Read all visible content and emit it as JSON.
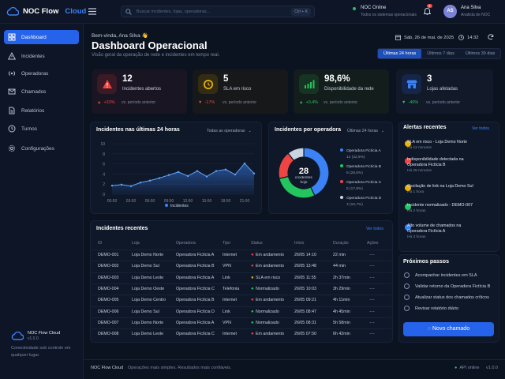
{
  "brand": {
    "name": "NOC Flow",
    "accent": "Cloud"
  },
  "search": {
    "placeholder": "Buscar incidentes, lojas, operadoras...",
    "shortcut": "Ctrl + K"
  },
  "status": {
    "title": "NOC Online",
    "subtitle": "Todos os sistemas operacionais",
    "color": "#22c55e"
  },
  "notifications": {
    "count": "3"
  },
  "user": {
    "initials": "AS",
    "name": "Ana Silva",
    "role": "Analista de NOC"
  },
  "sidebar": {
    "items": [
      {
        "label": "Dashboard",
        "icon": "grid-icon"
      },
      {
        "label": "Incidentes",
        "icon": "warning-icon"
      },
      {
        "label": "Operadoras",
        "icon": "signal-icon"
      },
      {
        "label": "Chamados",
        "icon": "ticket-icon"
      },
      {
        "label": "Relatórios",
        "icon": "document-icon"
      },
      {
        "label": "Turnos",
        "icon": "clock-icon"
      },
      {
        "label": "Configurações",
        "icon": "gear-icon"
      }
    ],
    "footer": {
      "name": "NOC Flow Cloud",
      "version": "v1.0.0",
      "caption": "Conectividade sob controle em qualquer lugar."
    }
  },
  "header": {
    "welcome": "Bem-vinda, Ana Silva 👋",
    "title": "Dashboard Operacional",
    "subtitle": "Visão geral da operação de rede e incidentes em tempo real.",
    "date": "Sáb, 26 de mai. de 2025",
    "time": "14:32"
  },
  "range_tabs": [
    "Últimas 24 horas",
    "Últimos 7 dias",
    "Últimos 30 dias"
  ],
  "kpis": [
    {
      "value": "12",
      "label": "Incidentes abertos",
      "delta": "+33%",
      "compare": "vs. período anterior",
      "color": "#ef4444",
      "bg": "#2a1620",
      "icon": "alert-triangle-icon"
    },
    {
      "value": "5",
      "label": "SLA em risco",
      "delta": "-17%",
      "compare": "vs. período anterior",
      "color": "#eab308",
      "bg": "#2a2616",
      "icon": "clock-icon"
    },
    {
      "value": "98,6%",
      "label": "Disponibilidade da rede",
      "delta": "+0,4%",
      "compare": "vs. período anterior",
      "color": "#22c55e",
      "bg": "#13261d",
      "icon": "bars-icon"
    },
    {
      "value": "3",
      "label": "Lojas afetadas",
      "delta": "-40%",
      "compare": "vs. período anterior",
      "color": "#3b82f6",
      "bg": "#131f38",
      "icon": "store-icon"
    }
  ],
  "line_panel": {
    "title": "Incidentes nas últimas 24 horas",
    "filter": "Todas as operadoras"
  },
  "donut_panel": {
    "title": "Incidentes por operadora",
    "filter": "Últimas 24 horas",
    "center_value": "28",
    "center_label": "incidentes hoje"
  },
  "chart_data": [
    {
      "type": "area",
      "title": "Incidentes nas últimas 24 horas",
      "x": [
        "00:00",
        "01:30",
        "03:00",
        "04:30",
        "06:00",
        "07:30",
        "09:00",
        "10:30",
        "12:00",
        "13:30",
        "15:00",
        "16:30",
        "18:00",
        "19:30",
        "21:00",
        "22:30"
      ],
      "series": [
        {
          "name": "Incidentes",
          "values": [
            1.7,
            1.9,
            1.6,
            2.3,
            2.7,
            3.2,
            3.8,
            4.4,
            3.6,
            4.6,
            3.5,
            4.6,
            4.9,
            3.9,
            6.1,
            4.1
          ]
        }
      ],
      "xticks": [
        "00:00",
        "03:00",
        "06:00",
        "09:00",
        "12:00",
        "15:00",
        "18:00",
        "21:00"
      ],
      "yticks": [
        "0",
        "2",
        "4",
        "6",
        "8",
        "10"
      ],
      "ylim": [
        0,
        10
      ],
      "grid": true,
      "legend": "bottom",
      "color": "#3b82f6"
    },
    {
      "type": "pie",
      "title": "Incidentes por operadora",
      "slices": [
        {
          "name": "Operadora Fictícia A",
          "value": 12,
          "label": "12 (42,9%)",
          "color": "#3b82f6"
        },
        {
          "name": "Operadora Fictícia B",
          "value": 8,
          "label": "8 (28,6%)",
          "color": "#22c55e"
        },
        {
          "name": "Operadora Fictícia C",
          "value": 5,
          "label": "5 (17,9%)",
          "color": "#ef4444"
        },
        {
          "name": "Operadora Fictícia D",
          "value": 3,
          "label": "3 (10,7%)",
          "color": "#cbd5e1"
        }
      ]
    }
  ],
  "alerts": {
    "title": "Alertas recentes",
    "link": "Ver todos",
    "items": [
      {
        "text": "SLA em risco - Loja Demo Norte",
        "time": "Há 12 minutos",
        "color": "#eab308"
      },
      {
        "text": "Indisponibilidade detectada na Operadora Fictícia B",
        "time": "Há 25 minutos",
        "color": "#ef4444"
      },
      {
        "text": "Oscilação de link na Loja Demo Sul",
        "time": "Há 1 hora",
        "color": "#eab308"
      },
      {
        "text": "Incidente normalizado - DEMO-007",
        "time": "Há 2 horas",
        "color": "#22c55e"
      },
      {
        "text": "Alto volume de chamados na Operadora Fictícia A",
        "time": "Há 3 horas",
        "color": "#3b82f6"
      }
    ]
  },
  "table": {
    "title": "Incidentes recentes",
    "link": "Ver todos",
    "headers": [
      "ID",
      "Loja",
      "Operadora",
      "Tipo",
      "Status",
      "Início",
      "Duração",
      "Ações"
    ],
    "rows": [
      {
        "id": "DEMO-001",
        "loja": "Loja Demo Norte",
        "op": "Operadora Fictícia A",
        "tipo": "Internet",
        "status": "Em andamento",
        "sc": "#ef4444",
        "ini": "26/05 14:10",
        "dur": "22 min"
      },
      {
        "id": "DEMO-002",
        "loja": "Loja Demo Sul",
        "op": "Operadora Fictícia B",
        "tipo": "VPN",
        "status": "Em andamento",
        "sc": "#ef4444",
        "ini": "26/05 13:48",
        "dur": "44 min"
      },
      {
        "id": "DEMO-003",
        "loja": "Loja Demo Leste",
        "op": "Operadora Fictícia A",
        "tipo": "Link",
        "status": "SLA em risco",
        "sc": "#eab308",
        "ini": "26/05 11:55",
        "dur": "2h 37min"
      },
      {
        "id": "DEMO-004",
        "loja": "Loja Demo Oeste",
        "op": "Operadora Fictícia C",
        "tipo": "Telefonia",
        "status": "Normalizado",
        "sc": "#22c55e",
        "ini": "26/05 10:03",
        "dur": "3h 29min"
      },
      {
        "id": "DEMO-005",
        "loja": "Loja Demo Centro",
        "op": "Operadora Fictícia B",
        "tipo": "Internet",
        "status": "Em andamento",
        "sc": "#ef4444",
        "ini": "26/05 09:21",
        "dur": "4h 11min"
      },
      {
        "id": "DEMO-006",
        "loja": "Loja Demo Sul",
        "op": "Operadora Fictícia D",
        "tipo": "Link",
        "status": "Normalizado",
        "sc": "#22c55e",
        "ini": "26/05 08:47",
        "dur": "4h 45min"
      },
      {
        "id": "DEMO-007",
        "loja": "Loja Demo Norte",
        "op": "Operadora Fictícia A",
        "tipo": "VPN",
        "status": "Normalizado",
        "sc": "#22c55e",
        "ini": "26/05 08:31",
        "dur": "5h 58min"
      },
      {
        "id": "DEMO-008",
        "loja": "Loja Demo Leste",
        "op": "Operadora Fictícia C",
        "tipo": "Internet",
        "status": "Em andamento",
        "sc": "#ef4444",
        "ini": "26/05 07:50",
        "dur": "6h 42min"
      }
    ]
  },
  "next_steps": {
    "title": "Próximos passos",
    "items": [
      "Acompanhar incidentes em SLA",
      "Validar retorno da Operadora Fictícia B",
      "Atualizar status dos chamados críticos",
      "Revisar relatório diário"
    ],
    "button": "Novo chamado"
  },
  "footer": {
    "brand": "NOC Flow Cloud",
    "tagline": "Operações mais simples. Resultados mais confiáveis.",
    "api": "API online",
    "version": "v1.0.0"
  }
}
